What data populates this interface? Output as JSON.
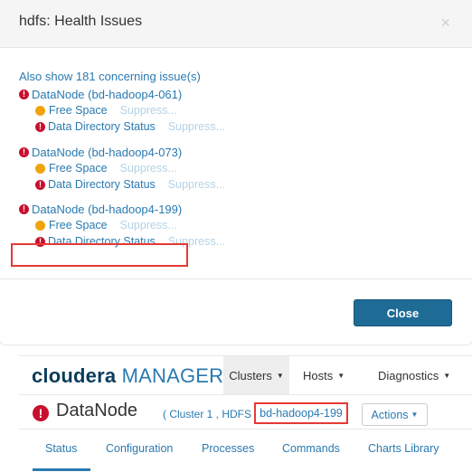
{
  "modal": {
    "title": "hdfs: Health Issues",
    "close_x": "×",
    "also_show": "Also show 181 concerning issue(s)",
    "groups": [
      {
        "node": "DataNode (bd-hadoop4-061)",
        "free_space": "Free Space",
        "free_space_action": "Suppress...",
        "data_dir": "Data Directory Status",
        "data_dir_action": "Suppress..."
      },
      {
        "node": "DataNode (bd-hadoop4-073)",
        "free_space": "Free Space",
        "free_space_action": "Suppress...",
        "data_dir": "Data Directory Status",
        "data_dir_action": "Suppress..."
      },
      {
        "node": "DataNode (bd-hadoop4-199)",
        "free_space": "Free Space",
        "free_space_action": "Suppress...",
        "data_dir": "Data Directory Status",
        "data_dir_action": "Suppress..."
      }
    ],
    "close_button": "Close"
  },
  "manager": {
    "logo_a": "cloudera",
    "logo_b": "MANAGER",
    "nav": {
      "clusters": "Clusters",
      "hosts": "Hosts",
      "diagnostics": "Diagnostics"
    },
    "entity": {
      "title": "DataNode",
      "context": "( Cluster 1 , HDFS",
      "host": "bd-hadoop4-199",
      "actions": "Actions"
    },
    "tabs": [
      "Status",
      "Configuration",
      "Processes",
      "Commands",
      "Charts Library"
    ]
  },
  "colors": {
    "link": "#2a7ab0",
    "error": "#c8102e",
    "warning": "#f0a30a",
    "primary_button": "#1e6c96",
    "highlight": "#e53935"
  }
}
